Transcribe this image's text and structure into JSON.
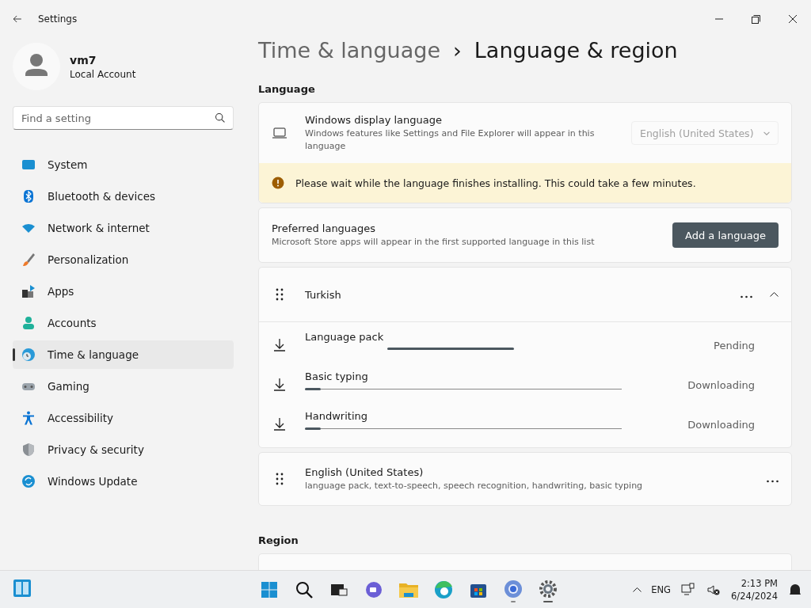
{
  "window": {
    "title": "Settings"
  },
  "account": {
    "name": "vm7",
    "type": "Local Account"
  },
  "search": {
    "placeholder": "Find a setting"
  },
  "sidebar": {
    "items": [
      {
        "label": "System",
        "selected": false
      },
      {
        "label": "Bluetooth & devices",
        "selected": false
      },
      {
        "label": "Network & internet",
        "selected": false
      },
      {
        "label": "Personalization",
        "selected": false
      },
      {
        "label": "Apps",
        "selected": false
      },
      {
        "label": "Accounts",
        "selected": false
      },
      {
        "label": "Time & language",
        "selected": true
      },
      {
        "label": "Gaming",
        "selected": false
      },
      {
        "label": "Accessibility",
        "selected": false
      },
      {
        "label": "Privacy & security",
        "selected": false
      },
      {
        "label": "Windows Update",
        "selected": false
      }
    ]
  },
  "breadcrumb": {
    "parent": "Time & language",
    "separator": "›",
    "current": "Language & region"
  },
  "language_section": {
    "heading": "Language",
    "display_language": {
      "title": "Windows display language",
      "description": "Windows features like Settings and File Explorer will appear in this language",
      "value": "English (United States)",
      "disabled": true
    },
    "notice": "Please wait while the language finishes installing. This could take a few minutes.",
    "preferred": {
      "title": "Preferred languages",
      "description": "Microsoft Store apps will appear in the first supported language in this list",
      "button": "Add a language"
    },
    "languages": [
      {
        "name": "Turkish",
        "expanded": true,
        "features": [
          {
            "name": "Language pack",
            "kind": "indeterminate",
            "level": 0.4,
            "status": "Pending"
          },
          {
            "name": "Basic typing",
            "kind": "progress",
            "level": 0.05,
            "status": "Downloading"
          },
          {
            "name": "Handwriting",
            "kind": "progress",
            "level": 0.05,
            "status": "Downloading"
          }
        ]
      },
      {
        "name": "English (United States)",
        "description": "language pack, text-to-speech, speech recognition, handwriting, basic typing"
      }
    ]
  },
  "region_section": {
    "heading": "Region"
  },
  "taskbar": {
    "language": "ENG",
    "time": "2:13 PM",
    "date": "6/24/2024"
  }
}
